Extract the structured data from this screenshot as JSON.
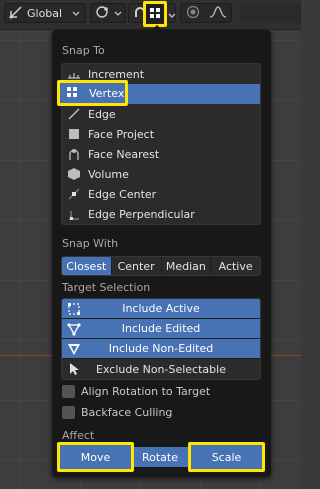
{
  "header": {
    "orientation": "Global",
    "snap_active_icon": "snap-grid-icon"
  },
  "snap_to": {
    "title": "Snap To",
    "items": [
      {
        "label": "Increment",
        "icon": "increment-icon",
        "selected": false
      },
      {
        "label": "Vertex",
        "icon": "vertex-icon",
        "selected": true
      },
      {
        "label": "Edge",
        "icon": "edge-icon",
        "selected": false
      },
      {
        "label": "Face Project",
        "icon": "face-project-icon",
        "selected": false
      },
      {
        "label": "Face Nearest",
        "icon": "face-nearest-icon",
        "selected": false
      },
      {
        "label": "Volume",
        "icon": "volume-icon",
        "selected": false
      },
      {
        "label": "Edge Center",
        "icon": "edge-center-icon",
        "selected": false
      },
      {
        "label": "Edge Perpendicular",
        "icon": "edge-perpendicular-icon",
        "selected": false
      }
    ]
  },
  "snap_with": {
    "title": "Snap With",
    "options": [
      "Closest",
      "Center",
      "Median",
      "Active"
    ],
    "selected": "Closest"
  },
  "target_selection": {
    "title": "Target Selection",
    "items": [
      {
        "label": "Include Active",
        "on": true
      },
      {
        "label": "Include Edited",
        "on": true
      },
      {
        "label": "Include Non-Edited",
        "on": true
      },
      {
        "label": "Exclude Non-Selectable",
        "on": false
      }
    ]
  },
  "options": {
    "align_rotation": "Align Rotation to Target",
    "backface_culling": "Backface Culling"
  },
  "affect": {
    "title": "Affect",
    "move": "Move",
    "rotate": "Rotate",
    "scale": "Scale"
  },
  "colors": {
    "accent": "#4772b3",
    "highlight": "#ffe600",
    "popover_bg": "#181818"
  }
}
